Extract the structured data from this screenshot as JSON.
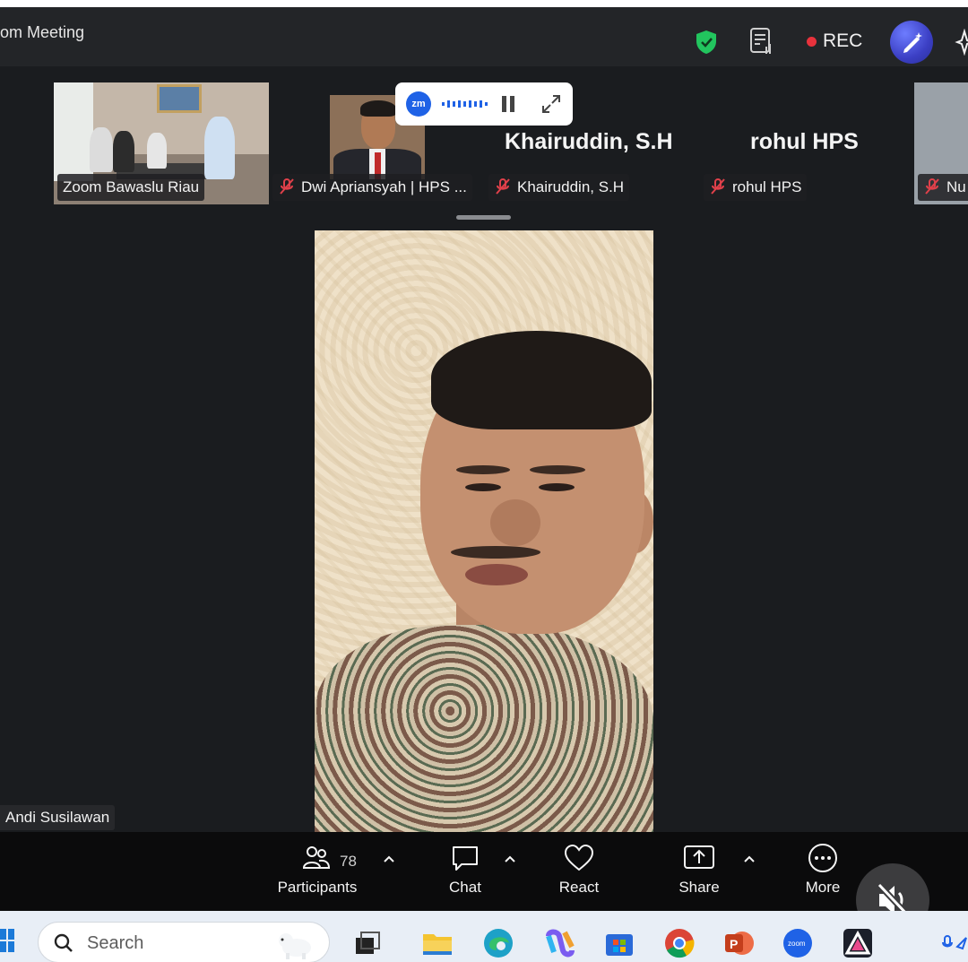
{
  "titlebar": {
    "title": "om Meeting",
    "rec_label": "REC"
  },
  "thumbnails": [
    {
      "label": "Zoom Bawaslu Riau",
      "muted": false
    },
    {
      "label": "Dwi Apriansyah | HPS ...",
      "muted": true
    },
    {
      "label": "Khairuddin, S.H",
      "display_name": "Khairuddin, S.H",
      "muted": true
    },
    {
      "label": "rohul HPS",
      "display_name": "rohul HPS",
      "muted": true
    },
    {
      "label": "Nu",
      "muted": true
    }
  ],
  "zm_indicator": {
    "logo": "zm"
  },
  "active_speaker": {
    "label": "Andi Susilawan"
  },
  "toolbar": {
    "participants": {
      "label": "Participants",
      "count": "78"
    },
    "chat": {
      "label": "Chat"
    },
    "react": {
      "label": "React"
    },
    "share": {
      "label": "Share"
    },
    "more": {
      "label": "More"
    }
  },
  "taskbar": {
    "search_placeholder": "Search",
    "apps": [
      "task-view-icon",
      "file-explorer-icon",
      "edge-icon",
      "copilot-icon",
      "store-icon",
      "chrome-icon",
      "powerpoint-icon",
      "zoom-icon",
      "affinity-icon"
    ],
    "zoom_label": "zoom"
  },
  "colors": {
    "rec": "#e8323c",
    "shield": "#22c55e",
    "muted_mic": "#e0404a",
    "zoom_blue": "#1f62e6"
  }
}
